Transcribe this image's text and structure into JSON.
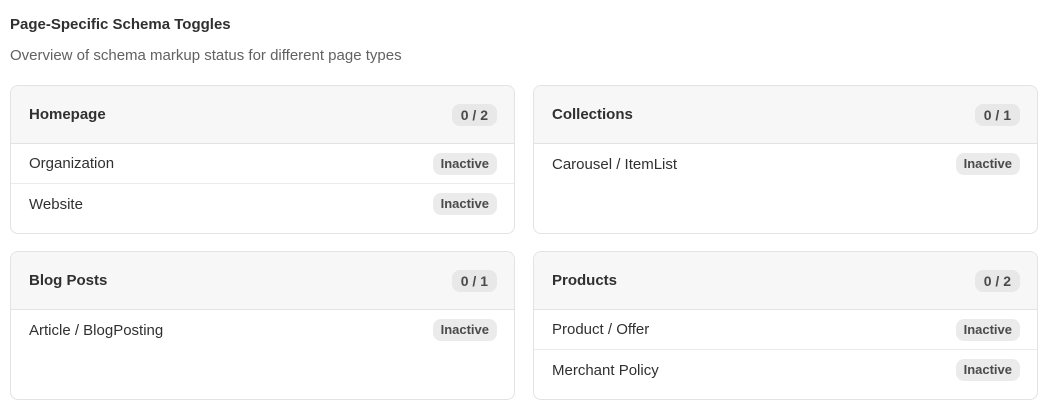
{
  "header": {
    "title": "Page-Specific Schema Toggles",
    "subtitle": "Overview of schema markup status for different page types"
  },
  "cards": [
    {
      "title": "Homepage",
      "count": "0 / 2",
      "rows": [
        {
          "label": "Organization",
          "status": "Inactive"
        },
        {
          "label": "Website",
          "status": "Inactive"
        }
      ]
    },
    {
      "title": "Collections",
      "count": "0 / 1",
      "rows": [
        {
          "label": "Carousel / ItemList",
          "status": "Inactive"
        }
      ]
    },
    {
      "title": "Blog Posts",
      "count": "0 / 1",
      "rows": [
        {
          "label": "Article / BlogPosting",
          "status": "Inactive"
        }
      ]
    },
    {
      "title": "Products",
      "count": "0 / 2",
      "rows": [
        {
          "label": "Product / Offer",
          "status": "Inactive"
        },
        {
          "label": "Merchant Policy",
          "status": "Inactive"
        }
      ]
    }
  ]
}
